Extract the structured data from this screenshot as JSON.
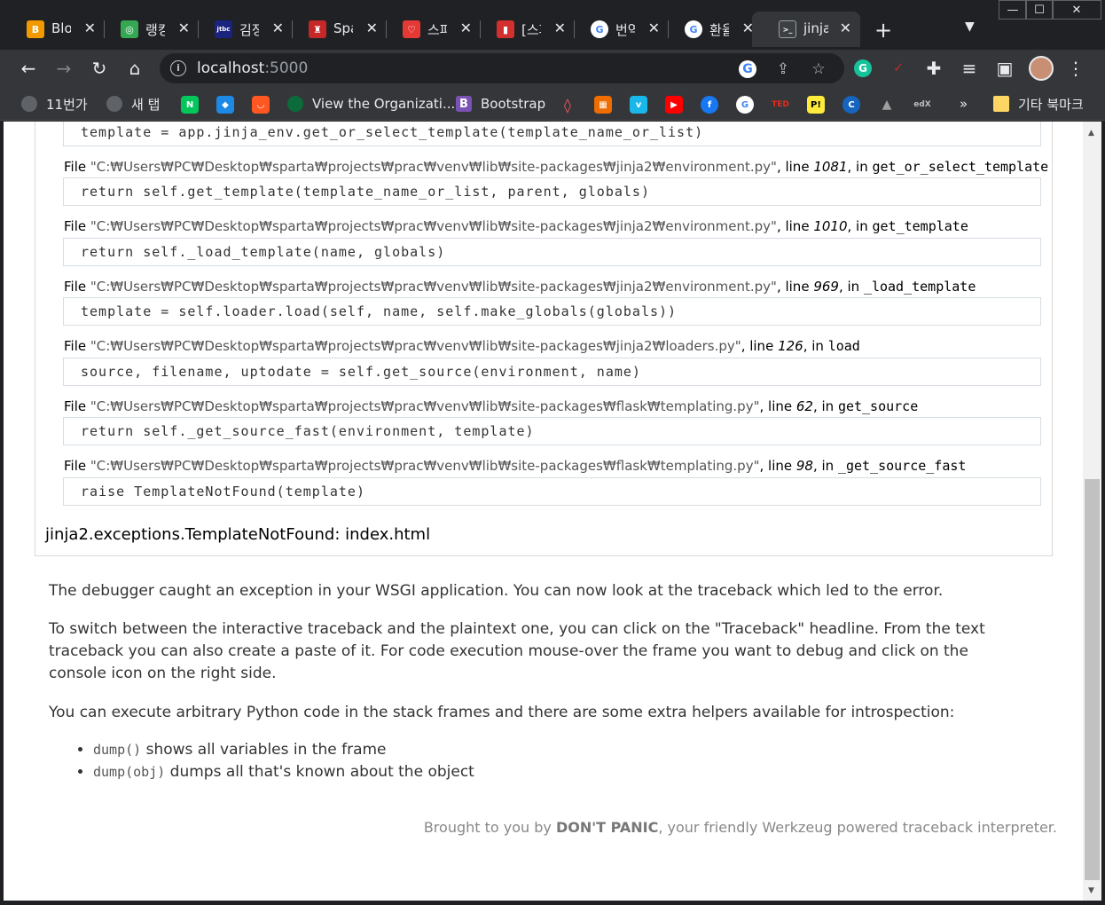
{
  "tabs": [
    {
      "title": "Blog",
      "color": "#f29900",
      "glyph": "B"
    },
    {
      "title": "랭킹",
      "color": "#34a853",
      "glyph": "◎"
    },
    {
      "title": "김정",
      "color": "#1a237e",
      "glyph": "jtbc"
    },
    {
      "title": "Spa",
      "color": "#c62828",
      "glyph": "♜"
    },
    {
      "title": "스파",
      "color": "#e53935",
      "glyph": "♡"
    },
    {
      "title": "[스파",
      "color": "#d32f2f",
      "glyph": "▮"
    },
    {
      "title": "번역",
      "color": "#ffffff",
      "glyph": "G"
    },
    {
      "title": "환율",
      "color": "#ffffff",
      "glyph": "G"
    },
    {
      "title": "jinja",
      "color": "#5f6368",
      "glyph": ">_"
    }
  ],
  "window": {
    "minimize": "—",
    "maximize": "☐",
    "close": "✕"
  },
  "address": {
    "host": "localhost",
    "port": ":5000"
  },
  "bookmarks": {
    "items": [
      {
        "label": "11번가"
      },
      {
        "label": "새 탭"
      },
      {
        "label": "View the Organizati..."
      },
      {
        "label": "Bootstrap"
      }
    ],
    "more": "»",
    "other_folder": "기타 북마크"
  },
  "traceback": {
    "frames": [
      {
        "code": "template = app.jinja_env.get_or_select_template(template_name_or_list)"
      },
      {
        "prefix": "File ",
        "path": "\"C:₩Users₩PC₩Desktop₩sparta₩projects₩prac₩venv₩lib₩site-packages₩jinja2₩environment.py\"",
        "line_label": ", line ",
        "line": "1081",
        "in_label": ", in ",
        "func": "get_or_select_template",
        "code": "return self.get_template(template_name_or_list, parent, globals)"
      },
      {
        "prefix": "File ",
        "path": "\"C:₩Users₩PC₩Desktop₩sparta₩projects₩prac₩venv₩lib₩site-packages₩jinja2₩environment.py\"",
        "line_label": ", line ",
        "line": "1010",
        "in_label": ", in ",
        "func": "get_template",
        "code": "return self._load_template(name, globals)"
      },
      {
        "prefix": "File ",
        "path": "\"C:₩Users₩PC₩Desktop₩sparta₩projects₩prac₩venv₩lib₩site-packages₩jinja2₩environment.py\"",
        "line_label": ", line ",
        "line": "969",
        "in_label": ", in ",
        "func": "_load_template",
        "code": "template = self.loader.load(self, name, self.make_globals(globals))"
      },
      {
        "prefix": "File ",
        "path": "\"C:₩Users₩PC₩Desktop₩sparta₩projects₩prac₩venv₩lib₩site-packages₩jinja2₩loaders.py\"",
        "line_label": ", line ",
        "line": "126",
        "in_label": ", in ",
        "func": "load",
        "code": "source, filename, uptodate = self.get_source(environment, name)"
      },
      {
        "prefix": "File ",
        "path": "\"C:₩Users₩PC₩Desktop₩sparta₩projects₩prac₩venv₩lib₩site-packages₩flask₩templating.py\"",
        "line_label": ", line ",
        "line": "62",
        "in_label": ", in ",
        "func": "get_source",
        "code": "return self._get_source_fast(environment, template)"
      },
      {
        "prefix": "File ",
        "path": "\"C:₩Users₩PC₩Desktop₩sparta₩projects₩prac₩venv₩lib₩site-packages₩flask₩templating.py\"",
        "line_label": ", line ",
        "line": "98",
        "in_label": ", in ",
        "func": "_get_source_fast",
        "code": "raise TemplateNotFound(template)"
      }
    ],
    "exception": "jinja2.exceptions.TemplateNotFound: index.html"
  },
  "explanation": {
    "p1": "The debugger caught an exception in your WSGI application. You can now look at the traceback which led to the error.",
    "p2": "To switch between the interactive traceback and the plaintext one, you can click on the \"Traceback\" headline. From the text traceback you can also create a paste of it. For code execution mouse-over the frame you want to debug and click on the console icon on the right side.",
    "p3": "You can execute arbitrary Python code in the stack frames and there are some extra helpers available for introspection:",
    "helpers": [
      {
        "code": "dump()",
        "text": " shows all variables in the frame"
      },
      {
        "code": "dump(obj)",
        "text": " dumps all that's known about the object"
      }
    ]
  },
  "footer": {
    "prefix": "Brought to you by ",
    "brand": "DON'T PANIC",
    "suffix": ", your friendly Werkzeug powered traceback interpreter."
  }
}
